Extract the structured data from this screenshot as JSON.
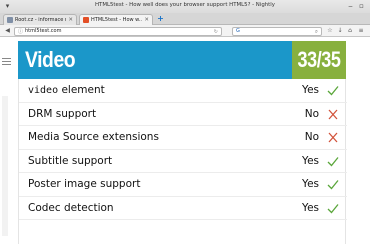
{
  "window": {
    "title": "HTML5test - How well does your browser support HTML5? - Nightly"
  },
  "tabs": [
    {
      "label": "Root.cz - informace n...",
      "favicon_color": "#7f8fa6"
    },
    {
      "label": "HTML5test - How w...",
      "favicon_color": "#e34f26"
    }
  ],
  "toolbar": {
    "url": "html5test.com",
    "search_engine": "G",
    "colors": {
      "new_tab": "#1a73c8"
    }
  },
  "page": {
    "section_title": "Video",
    "score": "33/35",
    "colors": {
      "header": "#1b97c9",
      "score": "#88b03e",
      "yes_icon": "#5aa63a",
      "no_icon": "#d2533b"
    },
    "rows": [
      {
        "label_code": "video",
        "label_rest": " element",
        "result": "Yes",
        "status": "pass",
        "icon": "checkmark-icon"
      },
      {
        "label_code": "",
        "label_rest": "DRM support",
        "result": "No",
        "status": "fail",
        "icon": "cross-icon"
      },
      {
        "label_code": "",
        "label_rest": "Media Source extensions",
        "result": "No",
        "status": "fail",
        "icon": "cross-icon"
      },
      {
        "label_code": "",
        "label_rest": "Subtitle support",
        "result": "Yes",
        "status": "pass",
        "icon": "checkmark-icon"
      },
      {
        "label_code": "",
        "label_rest": "Poster image support",
        "result": "Yes",
        "status": "pass",
        "icon": "checkmark-icon"
      },
      {
        "label_code": "",
        "label_rest": "Codec detection",
        "result": "Yes",
        "status": "pass",
        "icon": "checkmark-icon"
      }
    ]
  }
}
